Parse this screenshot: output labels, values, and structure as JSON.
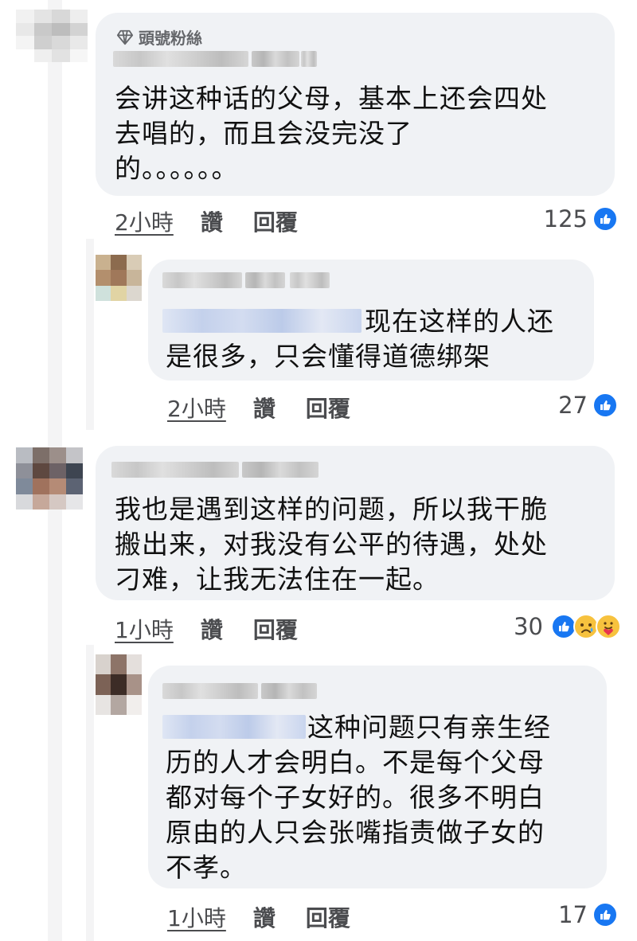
{
  "comments": [
    {
      "badge": "頭號粉絲",
      "text_lines": [
        "会讲这种话的父母，基本上还会四处",
        "去唱的，而且会没完没了",
        "的。。。。。。"
      ],
      "time": "2小時",
      "like_label": "讚",
      "reply_label": "回覆",
      "reaction_count": "125",
      "reactions": [
        "like-icon"
      ]
    },
    {
      "text_lines": [
        "现在这样的人还",
        "是很多，只会懂得道德绑架"
      ],
      "time": "2小時",
      "like_label": "讚",
      "reply_label": "回覆",
      "reaction_count": "27",
      "reactions": [
        "like-icon"
      ]
    },
    {
      "text_lines": [
        "我也是遇到这样的问题，所以我干脆",
        "搬出来，对我没有公平的待遇，处处",
        "刁难，让我无法住在一起。"
      ],
      "time": "1小時",
      "like_label": "讚",
      "reply_label": "回覆",
      "reaction_count": "30",
      "reactions": [
        "like-icon",
        "sad-icon",
        "care-icon"
      ]
    },
    {
      "text_lines": [
        "这种问题只有亲生经",
        "历的人才会明白。不是每个父母",
        "都对每个子女好的。很多不明白",
        "原由的人只会张嘴指责做子女的",
        "不孝。"
      ],
      "time": "1小時",
      "like_label": "讚",
      "reply_label": "回覆",
      "reaction_count": "17",
      "reactions": [
        "like-icon"
      ]
    }
  ],
  "colors": {
    "bubble": "#f0f2f5",
    "like_blue": "#1877f2",
    "meta_gray": "#4b4c4f",
    "emoji_yellow": "#f7c23e"
  }
}
